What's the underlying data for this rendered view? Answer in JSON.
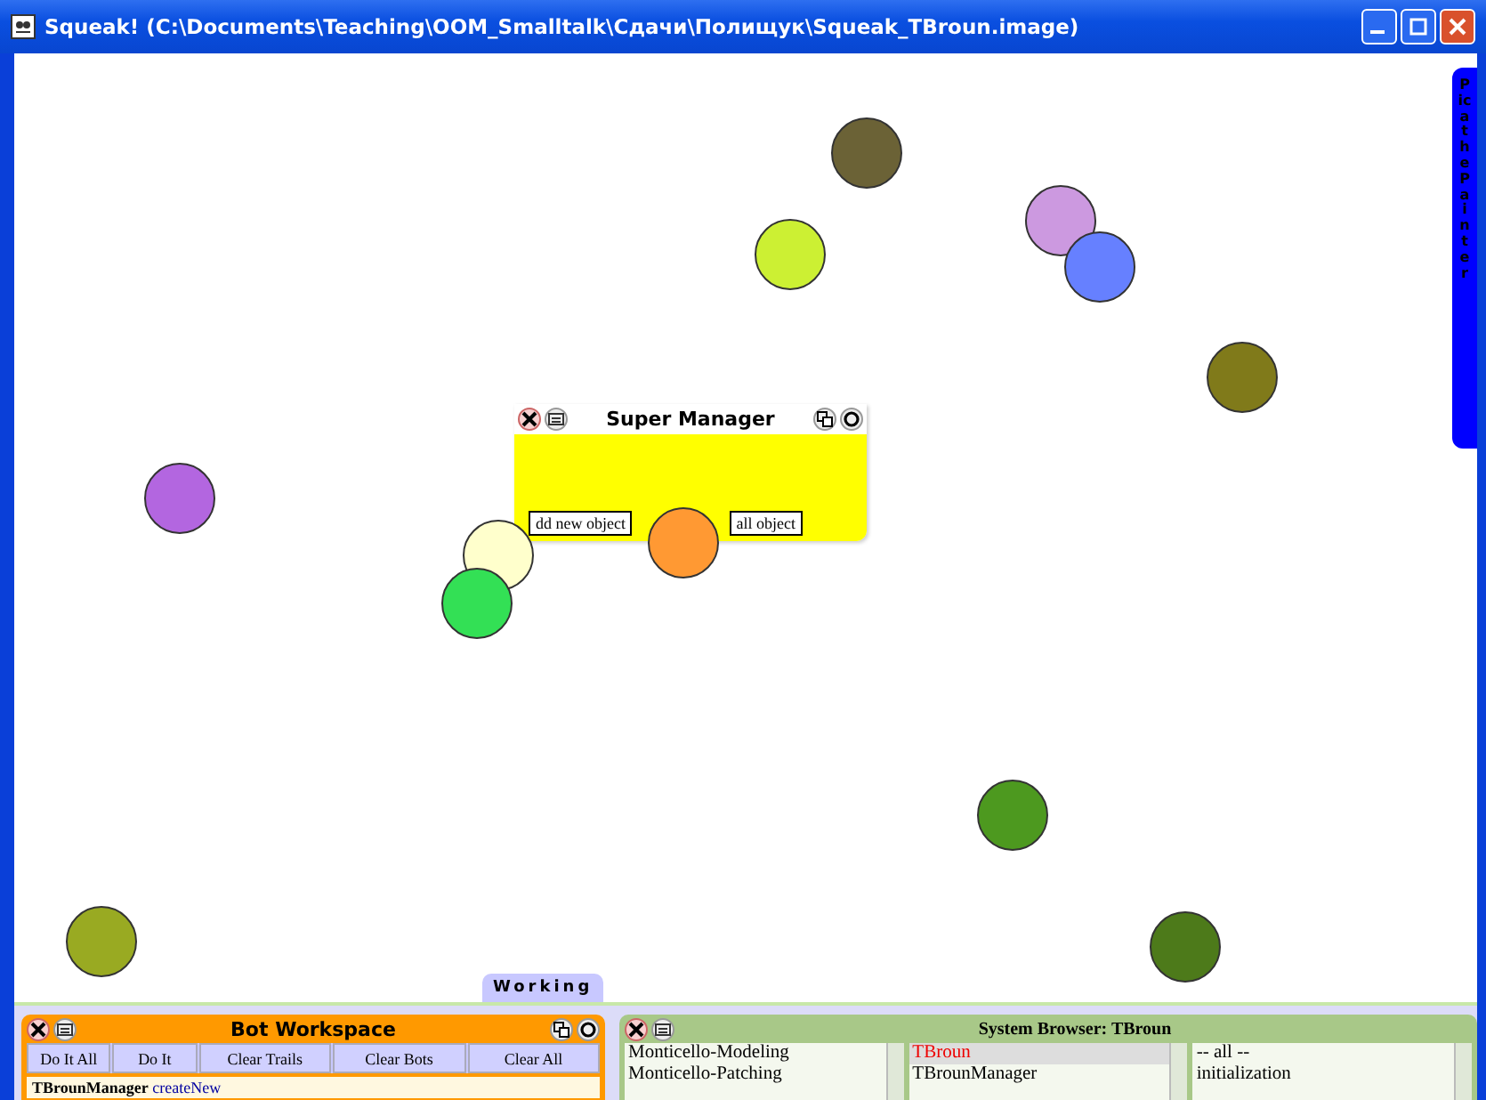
{
  "window": {
    "title": "Squeak! (C:\\Documents\\Teaching\\OOM_Smalltalk\\Сдачи\\Полищук\\Squeak_TBroun.image)"
  },
  "flap": {
    "label": "Pica the Painter"
  },
  "balls": [
    {
      "color": "#6b6236"
    },
    {
      "color": "#ccf033"
    },
    {
      "color": "#cc99e0"
    },
    {
      "color": "#6680ff"
    },
    {
      "color": "#807a1a"
    },
    {
      "color": "#b366e0"
    },
    {
      "color": "#ffffcc"
    },
    {
      "color": "#33e055"
    },
    {
      "color": "#ff9933"
    },
    {
      "color": "#4d991f"
    },
    {
      "color": "#99aa22"
    },
    {
      "color": "#4d7a1a"
    }
  ],
  "super_manager": {
    "title": "Super Manager",
    "buttons": [
      "dd new object",
      "all object"
    ]
  },
  "working_tab": {
    "label": "Working"
  },
  "bot_workspace": {
    "title": "Bot Workspace",
    "buttons": [
      "Do It All",
      "Do It",
      "Clear Trails",
      "Clear Bots",
      "Clear All"
    ],
    "code": {
      "receiver": "TBrounManager",
      "message": "createNew"
    }
  },
  "system_browser": {
    "title": "System Browser: TBroun",
    "packages": [
      {
        "label": "Monticello-Modeling",
        "selected": false
      },
      {
        "label": "Monticello-Patching",
        "selected": false
      }
    ],
    "classes": [
      {
        "label": "TBroun",
        "selected": true
      },
      {
        "label": "TBrounManager",
        "selected": false
      }
    ],
    "categories": [
      {
        "label": "-- all --",
        "selected": false
      },
      {
        "label": "initialization",
        "selected": false
      }
    ]
  }
}
